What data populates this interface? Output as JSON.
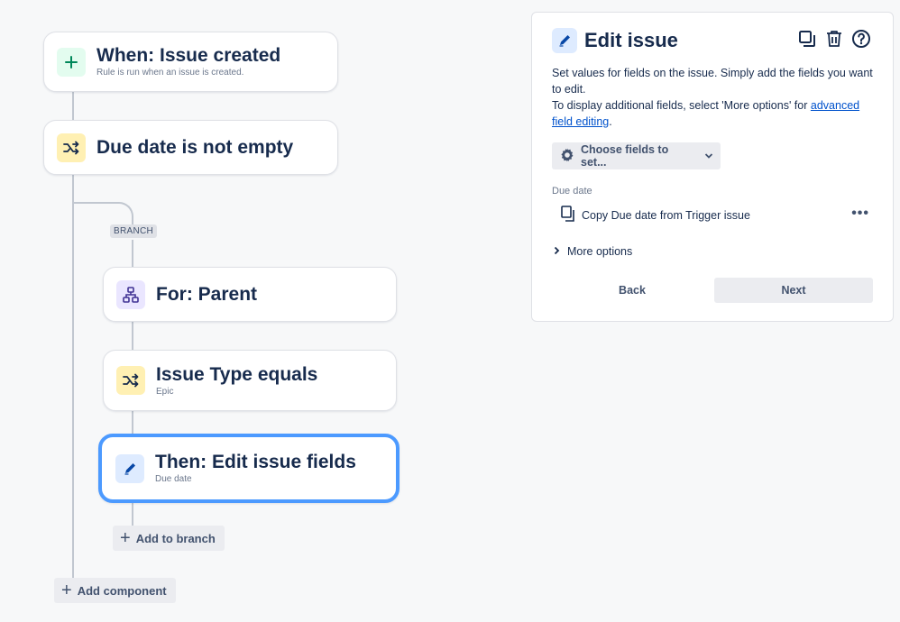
{
  "flow": {
    "trigger": {
      "title": "When: Issue created",
      "subtitle": "Rule is run when an issue is created.",
      "icon": "plus-icon"
    },
    "condition": {
      "title": "Due date is not empty",
      "icon": "shuffle-icon"
    },
    "branch_badge": "BRANCH",
    "branch_for": {
      "title": "For: Parent",
      "icon": "hierarchy-icon"
    },
    "branch_condition": {
      "title": "Issue Type equals",
      "subtitle": "Epic",
      "icon": "shuffle-icon"
    },
    "branch_action": {
      "title": "Then: Edit issue fields",
      "subtitle": "Due date",
      "icon": "pencil-icon"
    },
    "add_to_branch": "Add to branch",
    "add_component": "Add component"
  },
  "panel": {
    "title": "Edit issue",
    "tools": [
      "copy-icon",
      "trash-icon",
      "help-icon"
    ],
    "description_1": "Set values for fields on the issue. Simply add the fields you want to edit.",
    "description_2": "To display additional fields, select 'More options' for",
    "description_link": "advanced field editing",
    "description_end": ".",
    "choose_fields": "Choose fields to set...",
    "field_label": "Due date",
    "field_value": "Copy Due date from Trigger issue",
    "field_menu": "•••",
    "more_options": "More options",
    "back": "Back",
    "next": "Next"
  },
  "colors": {
    "accent": "#4c9aff",
    "link": "#0052cc",
    "text": "#172b4d"
  }
}
